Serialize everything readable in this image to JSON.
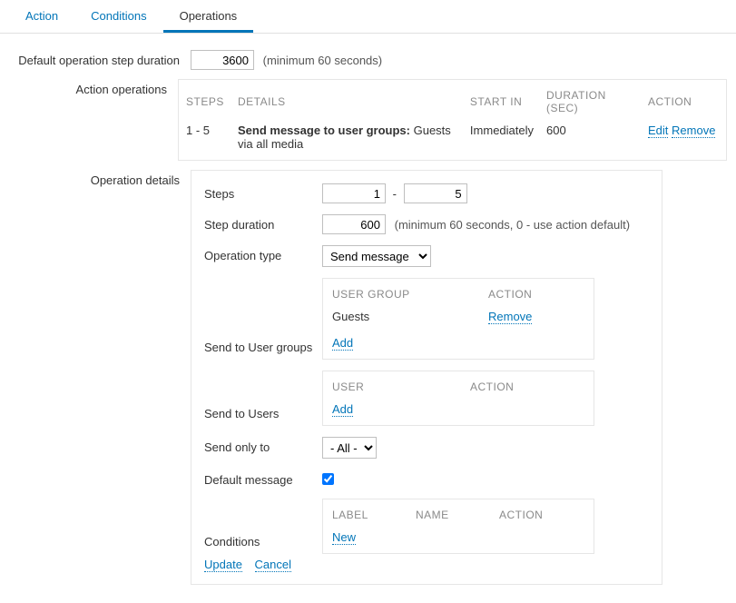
{
  "tabs": {
    "action": "Action",
    "conditions": "Conditions",
    "operations": "Operations"
  },
  "default_step": {
    "label": "Default operation step duration",
    "value": "3600",
    "hint": "(minimum 60 seconds)"
  },
  "action_ops": {
    "label": "Action operations",
    "headers": {
      "steps": "STEPS",
      "details": "DETAILS",
      "start_in": "START IN",
      "duration": "DURATION (SEC)",
      "action": "ACTION"
    },
    "row": {
      "steps": "1 - 5",
      "details_bold": "Send message to user groups:",
      "details_rest": " Guests via all media",
      "start_in": "Immediately",
      "duration": "600",
      "edit": "Edit",
      "remove": "Remove"
    }
  },
  "op_details": {
    "label": "Operation details",
    "steps": {
      "label": "Steps",
      "from": "1",
      "to": "5"
    },
    "step_duration": {
      "label": "Step duration",
      "value": "600",
      "hint": "(minimum 60 seconds, 0 - use action default)"
    },
    "op_type": {
      "label": "Operation type",
      "value": "Send message"
    },
    "user_groups": {
      "label": "Send to User groups",
      "headers": {
        "group": "USER GROUP",
        "action": "ACTION"
      },
      "row": {
        "name": "Guests",
        "remove": "Remove"
      },
      "add": "Add"
    },
    "users": {
      "label": "Send to Users",
      "headers": {
        "user": "USER",
        "action": "ACTION"
      },
      "add": "Add"
    },
    "send_only_to": {
      "label": "Send only to",
      "value": "- All -"
    },
    "default_message": {
      "label": "Default message"
    },
    "conditions": {
      "label": "Conditions",
      "headers": {
        "label": "LABEL",
        "name": "NAME",
        "action": "ACTION"
      },
      "new": "New"
    },
    "buttons": {
      "update": "Update",
      "cancel": "Cancel"
    }
  }
}
